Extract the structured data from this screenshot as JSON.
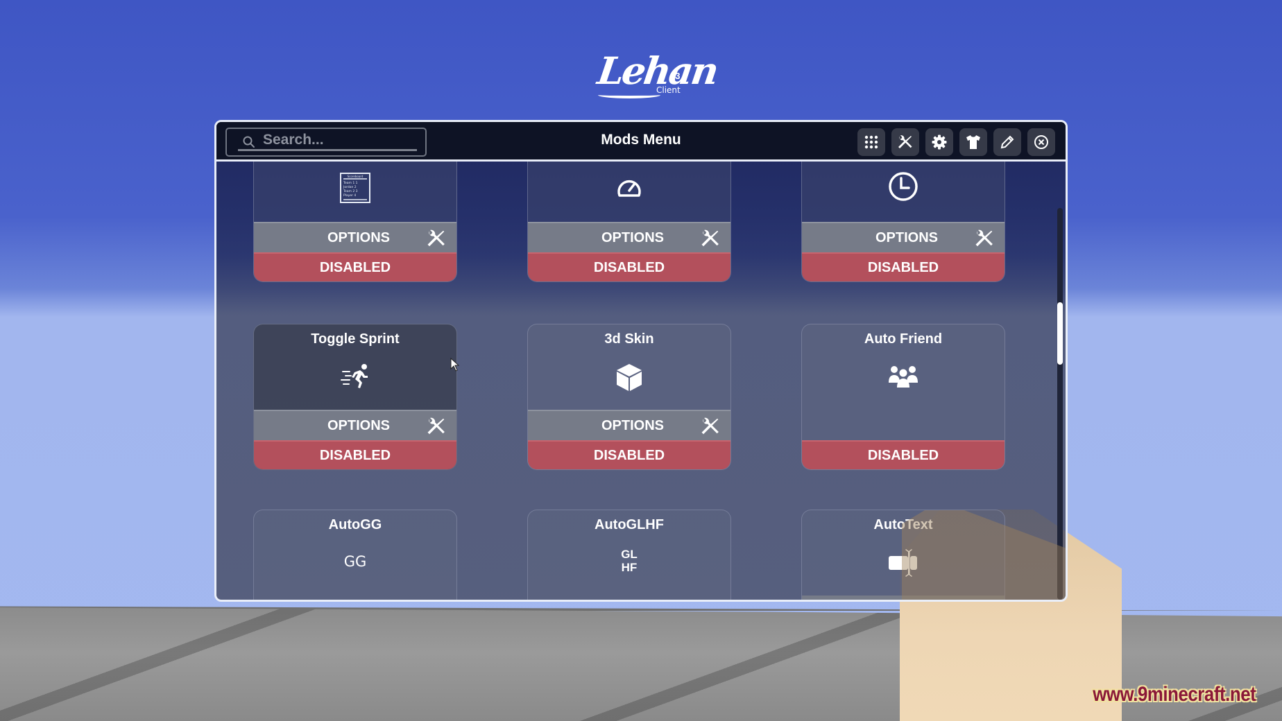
{
  "logo": {
    "script": "Lehan",
    "number": "23",
    "subtitle": "Client"
  },
  "header": {
    "title": "Mods Menu",
    "search": {
      "placeholder": "Search...",
      "value": ""
    },
    "toolbar": [
      {
        "id": "mods",
        "icon": "grid-icon"
      },
      {
        "id": "tools",
        "icon": "wrench-screwdriver-icon"
      },
      {
        "id": "settings",
        "icon": "gear-icon"
      },
      {
        "id": "cosmetics",
        "icon": "tshirt-icon"
      },
      {
        "id": "edit-hud",
        "icon": "pencil-icon"
      },
      {
        "id": "close",
        "icon": "close-circle-icon"
      }
    ]
  },
  "mods": [
    {
      "name": "",
      "icon": "scoreboard-icon",
      "scoreboard_preview": [
        "Scoreboard",
        "Team 1  1",
        "Jordan  2",
        "Team 2  3",
        "Player  4"
      ],
      "has_options": true,
      "options_label": "OPTIONS",
      "status": "DISABLED"
    },
    {
      "name": "",
      "icon": "speedometer-icon",
      "has_options": true,
      "options_label": "OPTIONS",
      "status": "DISABLED"
    },
    {
      "name": "",
      "icon": "clock-icon",
      "has_options": true,
      "options_label": "OPTIONS",
      "status": "DISABLED"
    },
    {
      "name": "Toggle Sprint",
      "icon": "running-person-icon",
      "has_options": true,
      "options_label": "OPTIONS",
      "status": "DISABLED",
      "hovered": true
    },
    {
      "name": "3d Skin",
      "icon": "cube-icon",
      "has_options": true,
      "options_label": "OPTIONS",
      "status": "DISABLED"
    },
    {
      "name": "Auto Friend",
      "icon": "users-group-icon",
      "has_options": false,
      "status": "DISABLED"
    },
    {
      "name": "AutoGG",
      "icon": "text-gg-icon",
      "icon_text": "GG"
    },
    {
      "name": "AutoGLHF",
      "icon": "text-glhf-icon",
      "icon_text_lines": [
        "GL",
        "HF"
      ]
    },
    {
      "name": "AutoText",
      "icon": "text-cursor-box-icon"
    }
  ],
  "scroll": {
    "position_fraction": 0.24,
    "visible_fraction": 0.16
  },
  "colors": {
    "disabled": "#b3505c",
    "options": "#767b88",
    "header": "#0e1325",
    "panel_border": "#e9eef8"
  },
  "watermark": "www.9minecraft.net"
}
